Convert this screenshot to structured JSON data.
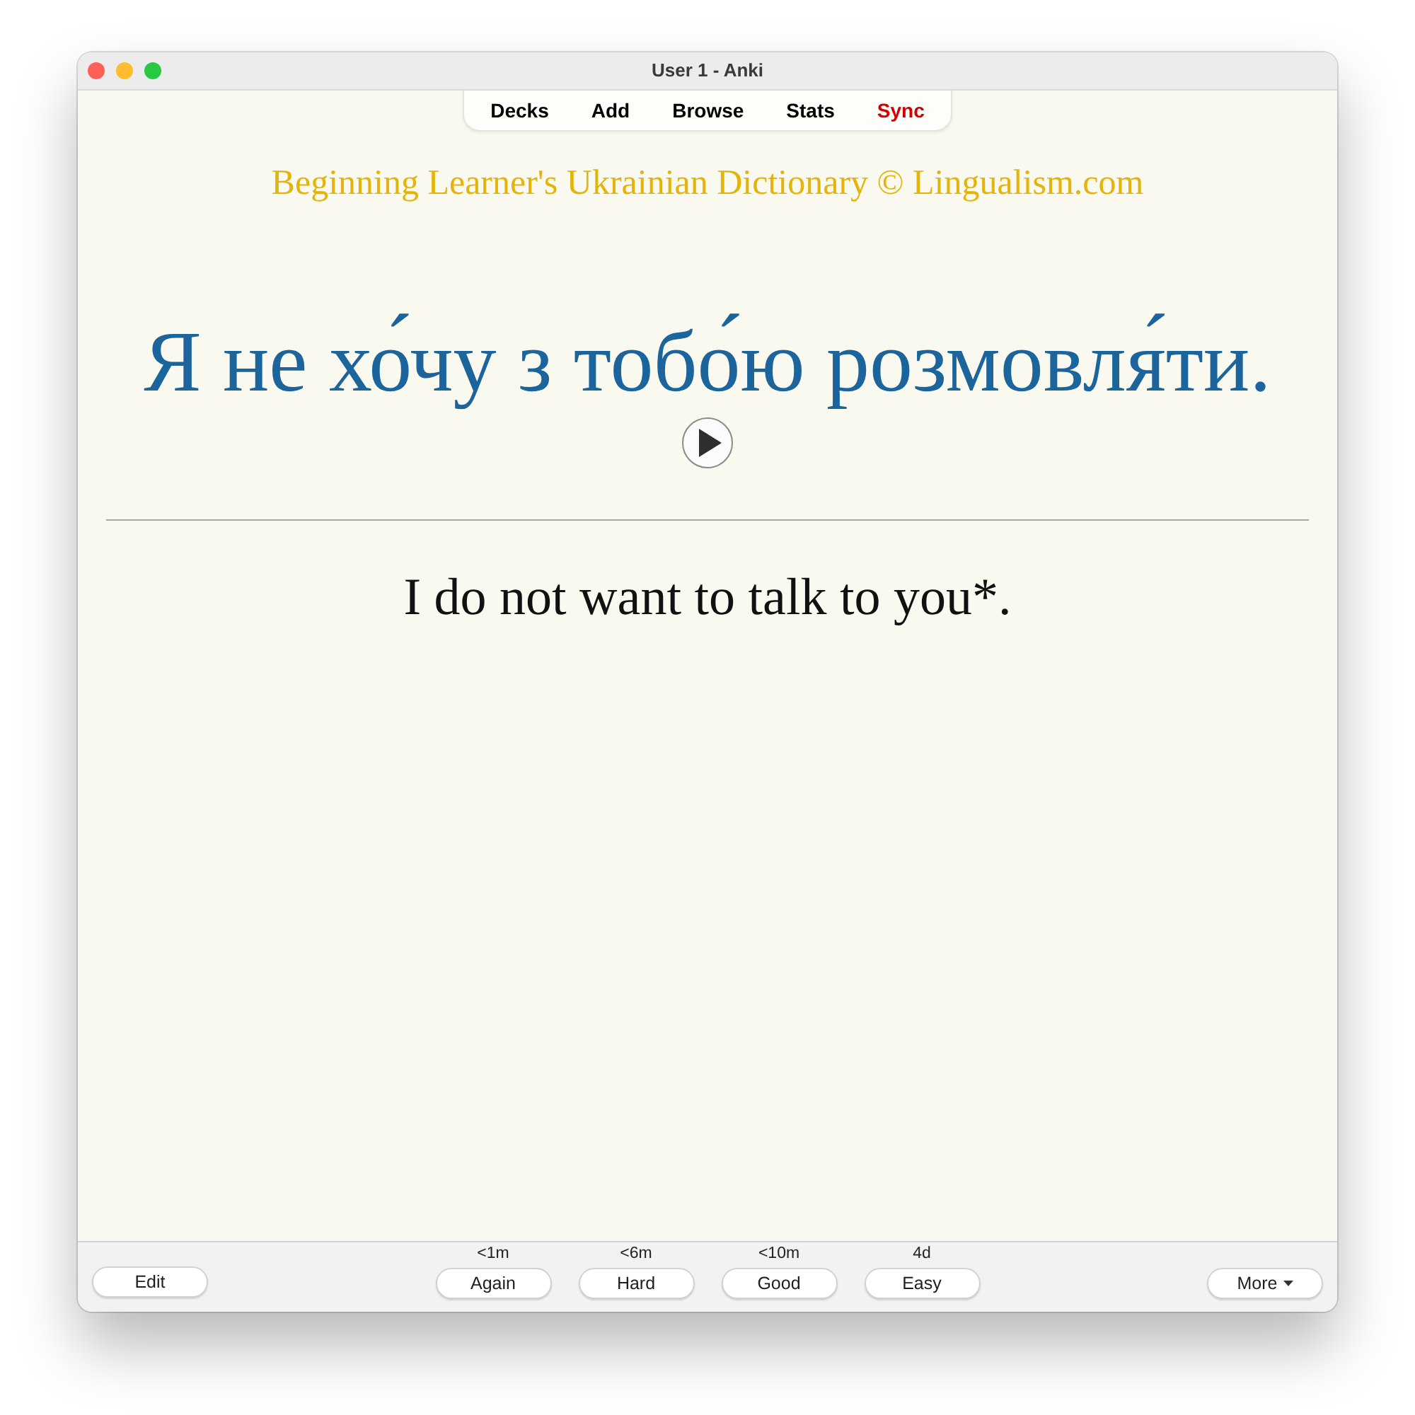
{
  "window": {
    "title": "User 1 - Anki"
  },
  "toolbar": {
    "items": [
      {
        "label": "Decks",
        "color": "#000000"
      },
      {
        "label": "Add",
        "color": "#000000"
      },
      {
        "label": "Browse",
        "color": "#000000"
      },
      {
        "label": "Stats",
        "color": "#000000"
      },
      {
        "label": "Sync",
        "color": "#d40000"
      }
    ]
  },
  "card": {
    "source": "Beginning Learner's Ukrainian Dictionary © Lingualism.com",
    "front": "Я не хо́чу з тобо́ю розмовля́ти.",
    "back": "I do not want to talk to you*."
  },
  "bottom_bar": {
    "edit": "Edit",
    "answers": [
      {
        "interval": "<1m",
        "label": "Again"
      },
      {
        "interval": "<6m",
        "label": "Hard"
      },
      {
        "interval": "<10m",
        "label": "Good"
      },
      {
        "interval": "4d",
        "label": "Easy"
      }
    ],
    "more": "More"
  }
}
